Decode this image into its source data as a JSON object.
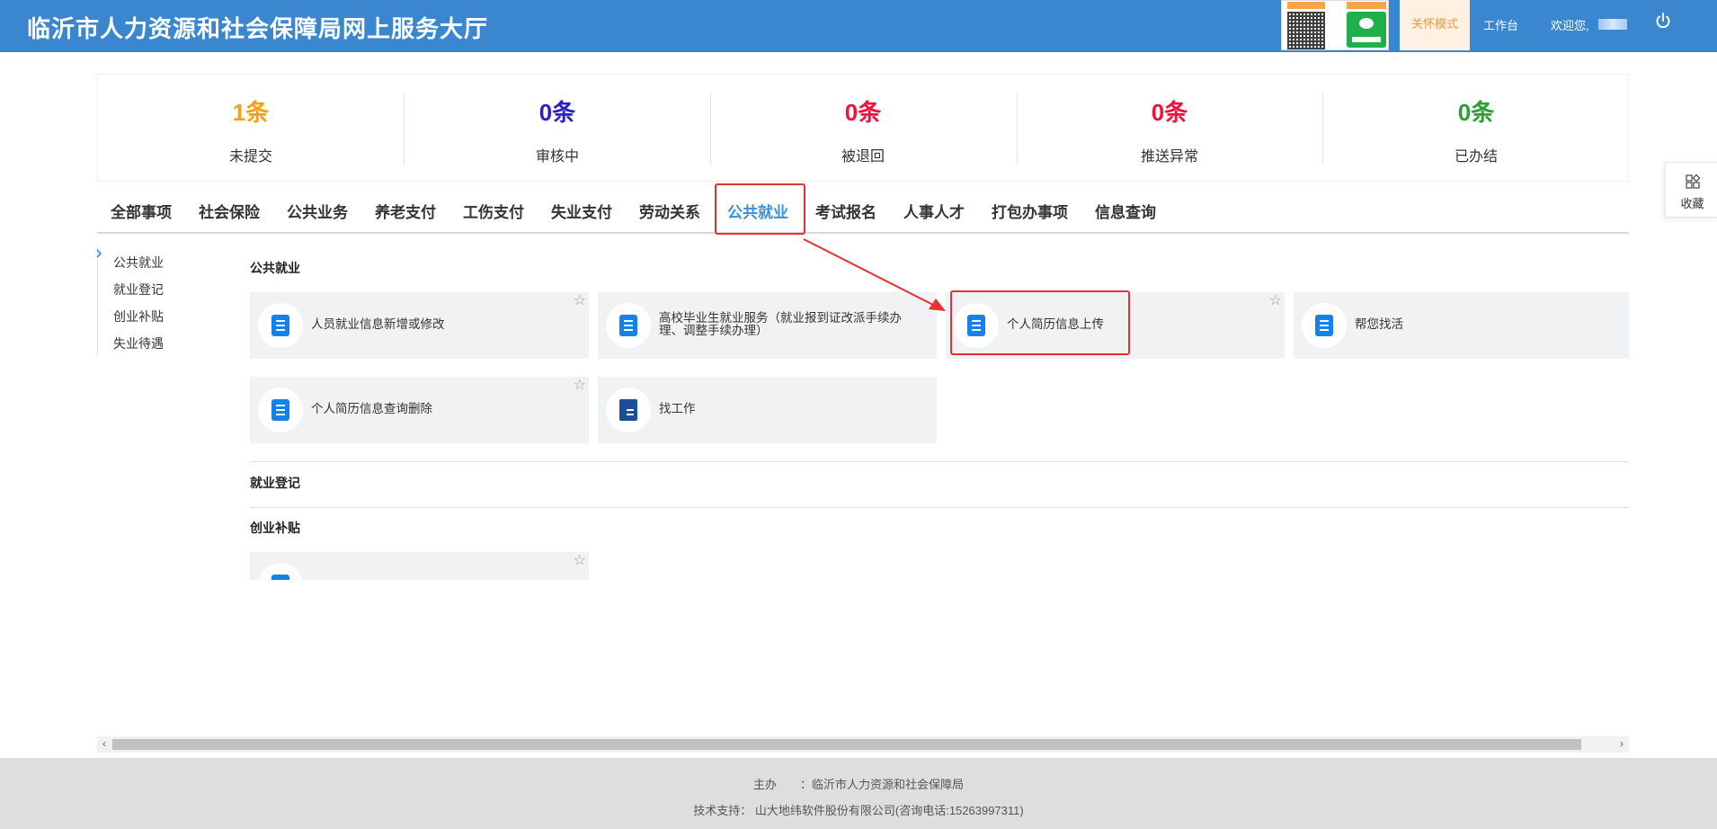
{
  "header": {
    "title": "临沂市人力资源和社会保障局网上服务大厅",
    "care_mode": "关怀模式",
    "workbench": "工作台",
    "welcome": "欢迎您,",
    "brand_color": "#3a87d0"
  },
  "stats": [
    {
      "value": "1条",
      "label": "未提交",
      "color": "#f5a00f"
    },
    {
      "value": "0条",
      "label": "审核中",
      "color": "#2a1fc8"
    },
    {
      "value": "0条",
      "label": "被退回",
      "color": "#f0123c"
    },
    {
      "value": "0条",
      "label": "推送异常",
      "color": "#f0123c"
    },
    {
      "value": "0条",
      "label": "已办结",
      "color": "#2c9e32"
    }
  ],
  "collect": {
    "label": "收藏",
    "icon": "collect-icon"
  },
  "tabs": [
    {
      "label": "全部事项"
    },
    {
      "label": "社会保险"
    },
    {
      "label": "公共业务"
    },
    {
      "label": "养老支付"
    },
    {
      "label": "工伤支付"
    },
    {
      "label": "失业支付"
    },
    {
      "label": "劳动关系"
    },
    {
      "label": "公共就业",
      "active": true
    },
    {
      "label": "考试报名"
    },
    {
      "label": "人事人才"
    },
    {
      "label": "打包办事项"
    },
    {
      "label": "信息查询"
    }
  ],
  "left_menu": [
    "公共就业",
    "就业登记",
    "创业补贴",
    "失业待遇"
  ],
  "sections": {
    "public_employment": {
      "title": "公共就业",
      "cards": [
        {
          "label": "人员就业信息新增或修改",
          "icon": "document-icon"
        },
        {
          "label": "高校毕业生就业服务（就业报到证改派手续办理、调整手续办理）",
          "icon": "document-icon"
        },
        {
          "label": "个人简历信息上传",
          "icon": "document-icon"
        },
        {
          "label": "帮您找活",
          "icon": "document-icon"
        },
        {
          "label": "个人简历信息查询删除",
          "icon": "document-icon"
        },
        {
          "label": "找工作",
          "icon": "folder-icon"
        }
      ]
    },
    "registration": {
      "title": "就业登记"
    },
    "subsidy": {
      "title": "创业补贴"
    }
  },
  "footer": {
    "host": "主办　　：临沂市人力资源和社会保障局",
    "support": "技术支持：  山大地纬软件股份有限公司(咨询电话:15263997311)"
  }
}
